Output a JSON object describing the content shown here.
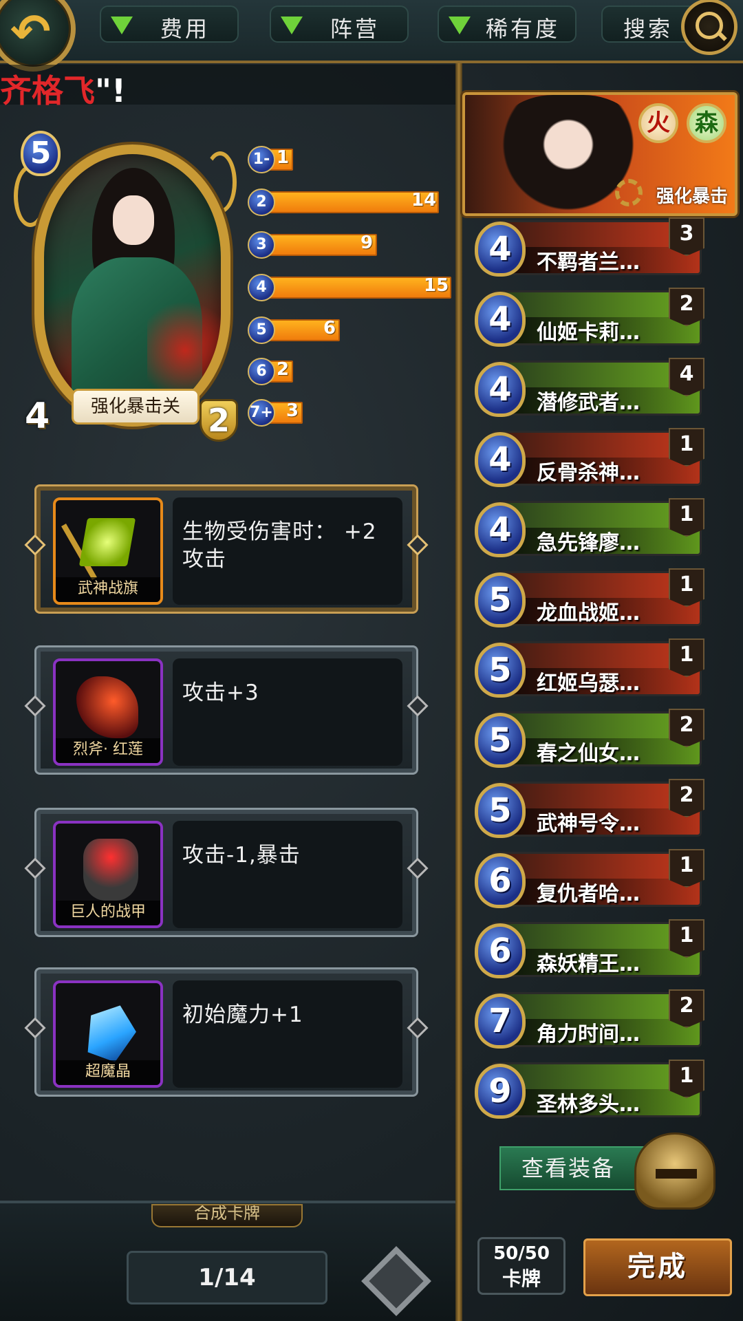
{
  "topbar": {
    "filters": [
      {
        "label": "费用"
      },
      {
        "label": "阵营"
      },
      {
        "label": "稀有度"
      }
    ],
    "search_label": "搜索"
  },
  "ticker": {
    "name": "齐格飞",
    "tail": "\"!"
  },
  "hero_card": {
    "cost": "5",
    "attack": "4",
    "health": "2",
    "name": "强化暴击关"
  },
  "cost_curve": [
    {
      "cost": "1-",
      "count": "1",
      "value": 1
    },
    {
      "cost": "2",
      "count": "14",
      "value": 14
    },
    {
      "cost": "3",
      "count": "9",
      "value": 9
    },
    {
      "cost": "4",
      "count": "15",
      "value": 15
    },
    {
      "cost": "5",
      "count": "6",
      "value": 6
    },
    {
      "cost": "6",
      "count": "2",
      "value": 2
    },
    {
      "cost": "7+",
      "count": "3",
      "value": 3
    }
  ],
  "equipment": [
    {
      "name": "武神战旗",
      "desc": "生物受伤害时： +2 攻击"
    },
    {
      "name": "烈斧· 红莲",
      "desc": "攻击+3"
    },
    {
      "name": "巨人的战甲",
      "desc": "攻击-1,暴击"
    },
    {
      "name": "超魔晶",
      "desc": "初始魔力+1"
    }
  ],
  "bottom": {
    "compose_tab": "合成卡牌",
    "page": "1/14"
  },
  "hero_banner": {
    "elements": [
      "火",
      "森"
    ],
    "skill": "强化暴击"
  },
  "deck": [
    {
      "cost": "4",
      "name": "不羁者兰…",
      "count": "3"
    },
    {
      "cost": "4",
      "name": "仙姬卡莉…",
      "count": "2"
    },
    {
      "cost": "4",
      "name": "潜修武者…",
      "count": "4"
    },
    {
      "cost": "4",
      "name": "反骨杀神…",
      "count": "1"
    },
    {
      "cost": "4",
      "name": "急先锋廖…",
      "count": "1"
    },
    {
      "cost": "5",
      "name": "龙血战姬…",
      "count": "1"
    },
    {
      "cost": "5",
      "name": "红姬乌瑟…",
      "count": "1"
    },
    {
      "cost": "5",
      "name": "春之仙女…",
      "count": "2"
    },
    {
      "cost": "5",
      "name": "武神号令…",
      "count": "2"
    },
    {
      "cost": "6",
      "name": "复仇者哈…",
      "count": "1"
    },
    {
      "cost": "6",
      "name": "森妖精王…",
      "count": "1"
    },
    {
      "cost": "7",
      "name": "角力时间…",
      "count": "2"
    },
    {
      "cost": "9",
      "name": "圣林多头…",
      "count": "1"
    }
  ],
  "right_bottom": {
    "view_equip": "查看装备",
    "deck_count": "50/50",
    "deck_count_label": "卡牌",
    "done": "完成"
  },
  "colors": {
    "accent_gold": "#c99a35",
    "bar_orange": "#f59a14",
    "cost_blue": "#1c2f86",
    "done_brown": "#8a4a18",
    "ticker_red": "#e2272a"
  }
}
